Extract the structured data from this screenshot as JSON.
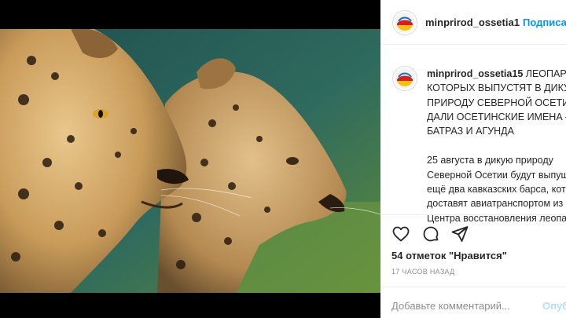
{
  "post": {
    "image_alt": "leopards-photo"
  },
  "header": {
    "username": "minprirod_ossetia1",
    "follow_label": "Подписаться"
  },
  "caption": {
    "username": "minprirod_ossetia15",
    "headline_lines": [
      "ЛЕОПАРДАМ,",
      "КОТОРЫХ ВЫПУСТЯТ В ДИКУЮ",
      "ПРИРОДУ СЕВЕРНОЙ ОСЕТИИ,",
      "ДАЛИ ОСЕТИНСКИЕ ИМЕНА —",
      "БАТРАЗ И АГУНДА"
    ],
    "body_lines": [
      "25 августа в дикую природу",
      "Северной Осетии будут выпущены",
      "ещё два кавказских барса, которых",
      "доставят авиатранспортом из",
      "Центра восстановления леопарда"
    ]
  },
  "actions": {
    "like_icon": "heart-icon",
    "comment_icon": "comment-icon",
    "share_icon": "share-icon"
  },
  "likes_text": "54 отметок \"Нравится\"",
  "time_text": "17 ЧАСОВ НАЗАД",
  "comment_box": {
    "placeholder": "Добавьте комментарий...",
    "publish_label": "Опубликовать"
  },
  "colors": {
    "link_blue": "#0095f6",
    "publish_disabled": "#b2dffc",
    "text": "#262626",
    "muted": "#8e8e8e"
  }
}
